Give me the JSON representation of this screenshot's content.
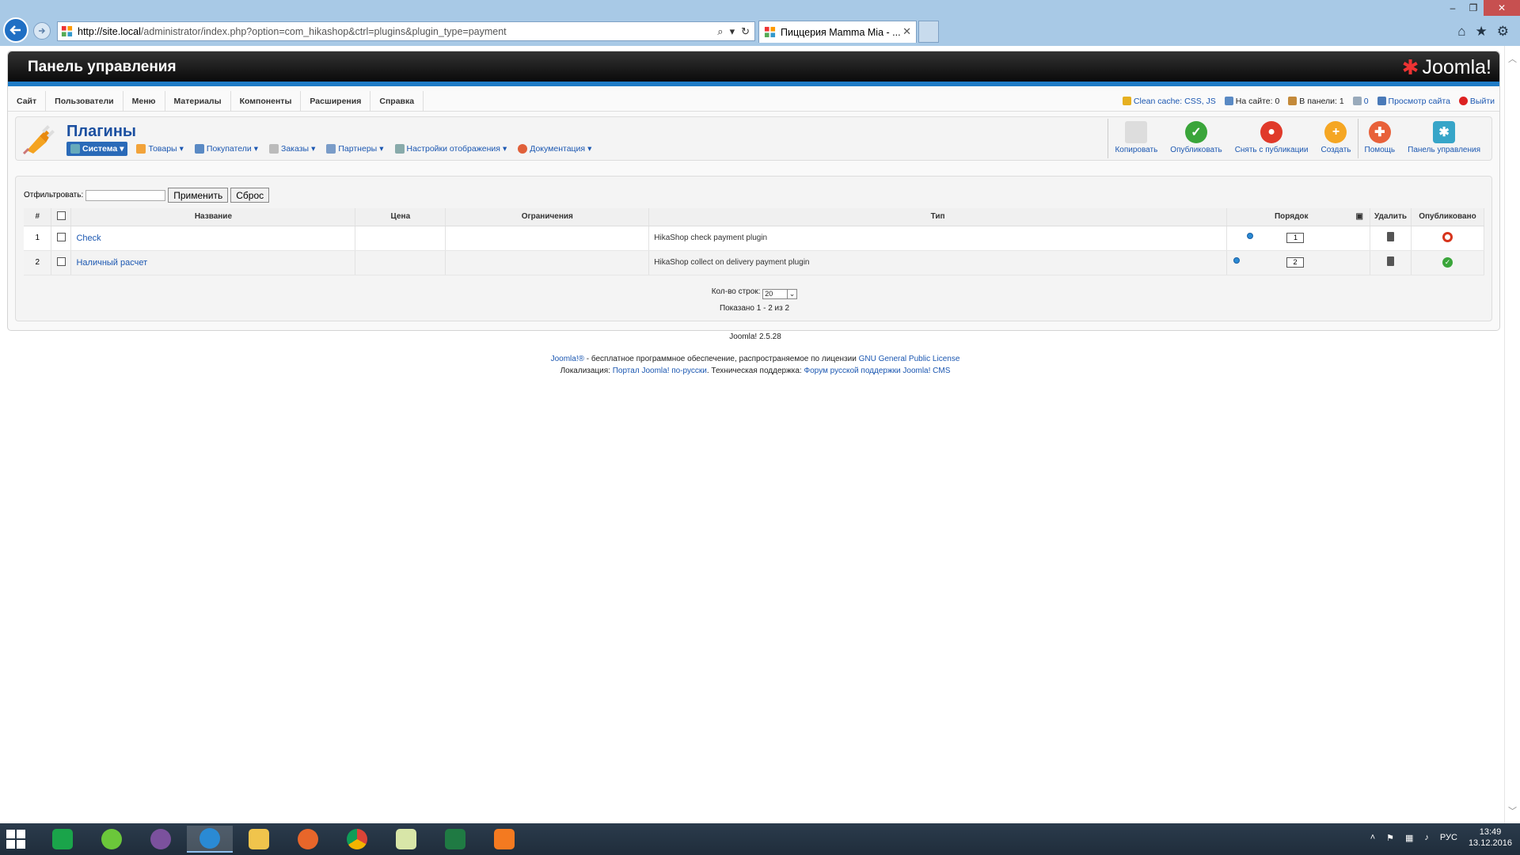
{
  "browser": {
    "url_host": "http://site.local",
    "url_path": "/administrator/index.php?option=com_hikashop&ctrl=plugins&plugin_type=payment",
    "tab_title": "Пиццерия Mamma Mia - ..."
  },
  "header": {
    "title": "Панель управления",
    "logo": "Joomla!"
  },
  "topmenu": [
    "Сайт",
    "Пользователи",
    "Меню",
    "Материалы",
    "Компоненты",
    "Расширения",
    "Справка"
  ],
  "status": {
    "clean_cache": "Clean cache: CSS, JS",
    "on_site": "На сайте: 0",
    "in_panel": "В панели: 1",
    "messages": "0",
    "view_site": "Просмотр сайта",
    "logout": "Выйти"
  },
  "page": {
    "title": "Плагины",
    "submenu": [
      "Система",
      "Товары",
      "Покупатели",
      "Заказы",
      "Партнеры",
      "Настройки отображения",
      "Документация"
    ]
  },
  "toolbar": {
    "copy": "Копировать",
    "publish": "Опубликовать",
    "unpublish": "Снять с публикации",
    "create": "Создать",
    "help": "Помощь",
    "panel": "Панель управления"
  },
  "filter": {
    "label": "Отфильтровать:",
    "value": "",
    "apply": "Применить",
    "reset": "Сброс"
  },
  "table": {
    "headers": {
      "num": "#",
      "name": "Название",
      "price": "Цена",
      "restrictions": "Ограничения",
      "type": "Тип",
      "order": "Порядок",
      "delete": "Удалить",
      "published": "Опубликовано"
    },
    "rows": [
      {
        "num": "1",
        "name": "Check",
        "type": "HikaShop check payment plugin",
        "order": "1",
        "published": false
      },
      {
        "num": "2",
        "name": "Наличный расчет",
        "type": "HikaShop collect on delivery payment plugin",
        "order": "2",
        "published": true
      }
    ]
  },
  "pagination": {
    "label": "Кол-во строк:",
    "value": "20",
    "shown": "Показано 1 - 2 из 2"
  },
  "footer": {
    "version": "Joomla! 2.5.28",
    "joomla_link": "Joomla!®",
    "license_text": " - бесплатное программное обеспечение, распространяемое по лицензии ",
    "license_link": "GNU General Public License",
    "loc_label": "Локализация: ",
    "loc_link": "Портал Joomla! по-русски",
    "support_label": ". Техническая поддержка: ",
    "support_link": "Форум русской поддержки Joomla! CMS"
  },
  "taskbar": {
    "lang": "РУС",
    "time": "13:49",
    "date": "13.12.2016"
  }
}
